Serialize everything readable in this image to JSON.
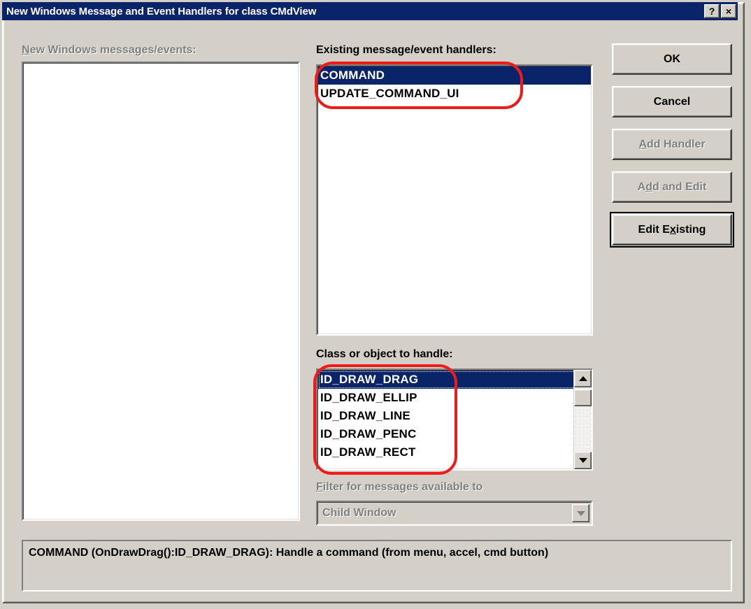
{
  "window": {
    "title": "New Windows Message and Event Handlers for class CMdView",
    "help_button": "?",
    "close_button": "×",
    "titlebar_color": "#0a246a",
    "face_color": "#d4d0c8"
  },
  "new_messages": {
    "label_prefix": "N",
    "label_rest": "ew Windows messages/events:",
    "disabled": true,
    "items": []
  },
  "existing_handlers": {
    "label": "Existing message/event handlers:",
    "items": [
      {
        "text": "COMMAND",
        "selected": true
      },
      {
        "text": "UPDATE_COMMAND_UI",
        "selected": false
      }
    ]
  },
  "class_or_object": {
    "label": "Class or object to handle:",
    "items": [
      {
        "text": "ID_DRAW_DRAG",
        "selected": true
      },
      {
        "text": "ID_DRAW_ELLIP",
        "selected": false
      },
      {
        "text": "ID_DRAW_LINE",
        "selected": false
      },
      {
        "text": "ID_DRAW_PENC",
        "selected": false
      },
      {
        "text": "ID_DRAW_RECT",
        "selected": false
      }
    ],
    "scrollbar": {
      "up_arrow": "▲",
      "down_arrow": "▼"
    }
  },
  "filter": {
    "label_prefix": "F",
    "label_rest": "ilter for messages available to",
    "disabled": true,
    "selected_value": "Child Window",
    "dropdown_arrow": "▼"
  },
  "buttons": [
    {
      "id": "ok",
      "label": "OK",
      "prefix": "",
      "accel": "",
      "suffix": "OK",
      "disabled": false,
      "default": false
    },
    {
      "id": "cancel",
      "label": "Cancel",
      "prefix": "",
      "accel": "",
      "suffix": "Cancel",
      "disabled": false,
      "default": false
    },
    {
      "id": "add-handler",
      "label": "Add Handler",
      "prefix": "",
      "accel": "A",
      "suffix": "dd Handler",
      "disabled": true,
      "default": false
    },
    {
      "id": "add-and-edit",
      "label": "Add and Edit",
      "prefix": "A",
      "accel": "d",
      "suffix": "d and Edit",
      "disabled": true,
      "default": false
    },
    {
      "id": "edit-existing",
      "label": "Edit Existing",
      "prefix": "Edit E",
      "accel": "x",
      "suffix": "isting",
      "disabled": false,
      "default": true
    }
  ],
  "description": {
    "text": "COMMAND (OnDrawDrag():ID_DRAW_DRAG):  Handle a command (from menu, accel, cmd button)"
  },
  "annotations": {
    "color": "#ee1b1b",
    "regions": [
      {
        "name": "existing-handlers-highlight"
      },
      {
        "name": "class-list-highlight"
      }
    ]
  }
}
